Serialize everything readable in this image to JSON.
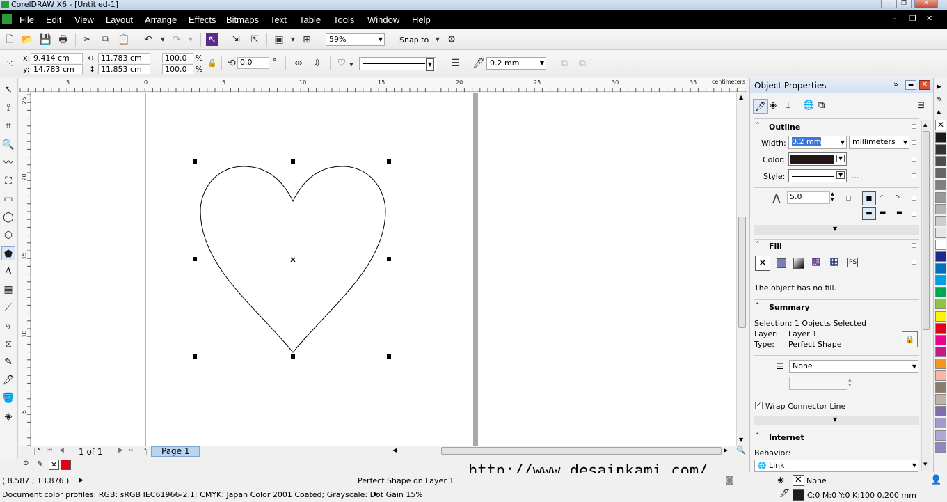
{
  "window": {
    "title": "CorelDRAW X6 - [Untitled-1]",
    "buttons": {
      "minimize": "–",
      "restore": "❐",
      "close": "✕"
    }
  },
  "menubar": {
    "items": [
      "File",
      "Edit",
      "View",
      "Layout",
      "Arrange",
      "Effects",
      "Bitmaps",
      "Text",
      "Table",
      "Tools",
      "Window",
      "Help"
    ],
    "doc_buttons": {
      "minimize": "–",
      "restore": "❐",
      "close": "✕"
    }
  },
  "standard_toolbar": {
    "zoom": "59%",
    "snap_to": "Snap to"
  },
  "property_bar": {
    "x_label": "x:",
    "y_label": "y:",
    "x": "9.414 cm",
    "y": "14.783 cm",
    "width": "11.783 cm",
    "height": "11.853 cm",
    "scale_x": "100.0",
    "scale_y": "100.0",
    "percent": "%",
    "rotation": "0.0",
    "degree": "°",
    "outline_width": "0.2 mm"
  },
  "rulers": {
    "unit": "centimeters",
    "h_ticks": [
      "5",
      "0",
      "5",
      "10",
      "15",
      "20",
      "25",
      "30",
      "35"
    ],
    "v_ticks": [
      "25",
      "20",
      "15",
      "10",
      "5"
    ]
  },
  "page_nav": {
    "counter": "1 of 1",
    "tab": "Page 1"
  },
  "docker": {
    "title": "Object Properties",
    "outline": {
      "header": "Outline",
      "width_label": "Width:",
      "width_value": "0.2 mm",
      "units": "millimeters",
      "color_label": "Color:",
      "style_label": "Style:",
      "more": "...",
      "miter": "5.0"
    },
    "fill": {
      "header": "Fill",
      "message": "The object has no fill."
    },
    "summary": {
      "header": "Summary",
      "selection": "Selection: 1 Objects Selected",
      "layer_label": "Layer:",
      "layer_value": "Layer 1",
      "type_label": "Type:",
      "type_value": "Perfect Shape",
      "wrap_value": "None",
      "wrap_connector": "Wrap Connector Line"
    },
    "internet": {
      "header": "Internet",
      "behavior_label": "Behavior:",
      "behavior_value": "Link"
    }
  },
  "palette": {
    "colors": [
      "#ffffff",
      "#1a1a1a",
      "#333333",
      "#4d4d4d",
      "#666666",
      "#808080",
      "#999999",
      "#b3b3b3",
      "#cccccc",
      "#e6e6e6",
      "#ffffff",
      "#1b2a8c",
      "#0072bc",
      "#00a0e4",
      "#00a651",
      "#8dc63f",
      "#fff200",
      "#e2001a",
      "#ec008c",
      "#c6168d",
      "#f7941d",
      "#fbb3a3",
      "#8c7b6b",
      "#bfb2a4",
      "#7d6fb0",
      "#a39cc9",
      "#b0a8d6",
      "#8f88c4"
    ]
  },
  "doc_palette": {
    "current": "#e2001a"
  },
  "status": {
    "coords": "( 8.587 ; 13.876 )",
    "object_info": "Perfect Shape on Layer 1",
    "fill_value": "None",
    "outline_value": "C:0 M:0 Y:0 K:100  0.200 mm",
    "profiles": "Document color profiles: RGB: sRGB IEC61966-2.1; CMYK: Japan Color 2001 Coated; Grayscale: Dot Gain 15%"
  },
  "watermark": "http://www.desainkami.com/"
}
